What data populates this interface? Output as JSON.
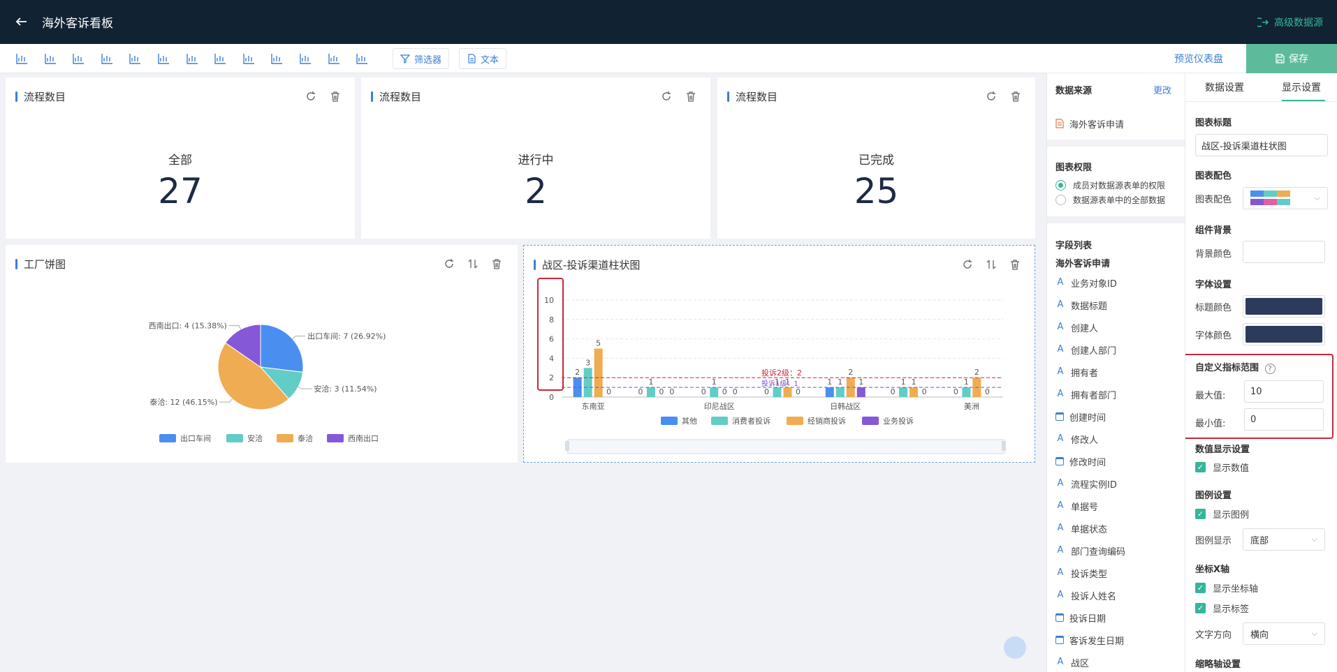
{
  "header": {
    "title": "海外客诉看板",
    "advanced_label": "高级数据源"
  },
  "toolbar": {
    "chart_icons": [
      "bar-chart-icon",
      "horizontal-bar-icon",
      "pie-chart-icon",
      "area-chart-icon",
      "radar-chart-icon",
      "list-icon",
      "table-icon",
      "number-icon",
      "line-chart-icon",
      "funnel-icon",
      "column-chart-icon",
      "scatter-icon",
      "combo-chart-icon"
    ],
    "filter_label": "筛选器",
    "text_label": "文本",
    "preview_label": "预览仪表盘",
    "save_label": "保存"
  },
  "kpi_cards": [
    {
      "title": "流程数目",
      "label": "全部",
      "value": "27"
    },
    {
      "title": "流程数目",
      "label": "进行中",
      "value": "2"
    },
    {
      "title": "流程数目",
      "label": "已完成",
      "value": "25"
    }
  ],
  "pie_card": {
    "title": "工厂饼图"
  },
  "bar_card": {
    "title": "战区-投诉渠道柱状图"
  },
  "chart_data": [
    {
      "type": "pie",
      "title": "工厂饼图",
      "labels": [
        "出口车间",
        "安洽",
        "泰洽",
        "西南出口"
      ],
      "values": [
        7,
        3,
        12,
        4
      ],
      "slice_labels": [
        "出口车间: 7 (26.92%)",
        "安洽: 3 (11.54%)",
        "泰洽: 12 (46.15%)",
        "西南出口: 4 (15.38%)"
      ],
      "colors": [
        "#4a8ff0",
        "#62cdc6",
        "#f0ac52",
        "#8458d6"
      ],
      "legend": "bottom"
    },
    {
      "type": "bar",
      "title": "战区-投诉渠道柱状图",
      "ylim": [
        0,
        10
      ],
      "yticks": [
        "10",
        "8",
        "6",
        "4",
        "2",
        "0"
      ],
      "x_visible_labels": [
        "东南亚",
        "印尼战区",
        "日韩战区",
        "美洲"
      ],
      "grid": true,
      "legend": "bottom",
      "series": [
        {
          "name": "其他",
          "color": "#4a8ff0",
          "values": [
            2,
            0,
            0,
            0,
            1,
            0,
            0
          ]
        },
        {
          "name": "消费者投诉",
          "color": "#62cdc6",
          "values": [
            3,
            1,
            1,
            1,
            1,
            1,
            1
          ]
        },
        {
          "name": "经销商投诉",
          "color": "#f0ac52",
          "values": [
            5,
            0,
            0,
            1,
            2,
            1,
            2
          ]
        },
        {
          "name": "业务投诉",
          "color": "#8458d6",
          "values": [
            0,
            0,
            0,
            0,
            1,
            0,
            0
          ]
        }
      ],
      "markline_labels": [
        "投诉2级：2",
        "投诉1级：1"
      ]
    }
  ],
  "data_source": {
    "heading": "数据来源",
    "change_label": "更改",
    "source_name": "海外客诉申请",
    "permission_heading": "图表权限",
    "perm_options": [
      "成员对数据源表单的权限",
      "数据源表单中的全部数据"
    ],
    "field_list_heading": "字段列表",
    "form_name": "海外客诉申请",
    "fields": [
      {
        "name": "业务对象ID",
        "kind": "text"
      },
      {
        "name": "数据标题",
        "kind": "text"
      },
      {
        "name": "创建人",
        "kind": "text"
      },
      {
        "name": "创建人部门",
        "kind": "text"
      },
      {
        "name": "拥有者",
        "kind": "text"
      },
      {
        "name": "拥有者部门",
        "kind": "text"
      },
      {
        "name": "创建时间",
        "kind": "date"
      },
      {
        "name": "修改人",
        "kind": "text"
      },
      {
        "name": "修改时间",
        "kind": "date"
      },
      {
        "name": "流程实例ID",
        "kind": "text"
      },
      {
        "name": "单据号",
        "kind": "text"
      },
      {
        "name": "单据状态",
        "kind": "text"
      },
      {
        "name": "部门查询编码",
        "kind": "text"
      },
      {
        "name": "投诉类型",
        "kind": "text"
      },
      {
        "name": "投诉人姓名",
        "kind": "text"
      },
      {
        "name": "投诉日期",
        "kind": "date"
      },
      {
        "name": "客诉发生日期",
        "kind": "date"
      },
      {
        "name": "战区",
        "kind": "text"
      }
    ]
  },
  "settings": {
    "tab_data": "数据设置",
    "tab_display": "显示设置",
    "chart_title_heading": "图表标题",
    "chart_title_value": "战区-投诉渠道柱状图",
    "chart_color_heading": "图表配色",
    "chart_color_label": "图表配色",
    "bg_heading": "组件背景",
    "bg_label": "背景颜色",
    "font_heading": "字体设置",
    "title_color_label": "标题颜色",
    "font_color_label": "字体颜色",
    "title_color": "#2c3a5c",
    "font_color": "#2c3a5c",
    "range_heading": "自定义指标范围",
    "max_label": "最大值:",
    "max_value": "10",
    "min_label": "最小值:",
    "min_value": "0",
    "value_display_heading": "数值显示设置",
    "show_value_label": "显示数值",
    "legend_heading": "图例设置",
    "show_legend_label": "显示图例",
    "legend_pos_label": "图例显示",
    "legend_pos_value": "底部",
    "x_axis_heading": "坐标X轴",
    "show_axis_label": "显示坐标轴",
    "show_tick_label": "显示标签",
    "text_dir_label": "文字方向",
    "text_dir_value": "横向",
    "thumb_axis_heading": "缩略轴设置"
  }
}
